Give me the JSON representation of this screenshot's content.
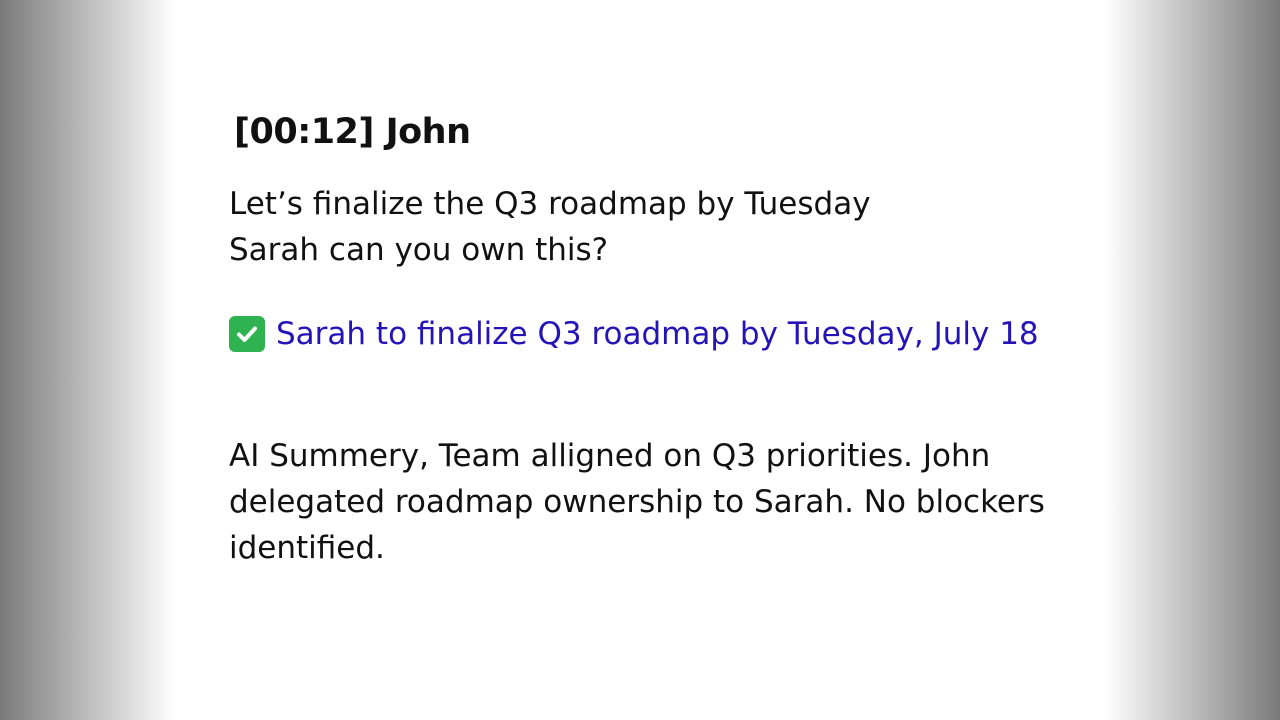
{
  "speaker": {
    "timestamp_label": "[00:12] John"
  },
  "message": {
    "lines": [
      "Let’s finalize the Q3 roadmap by Tuesday",
      "Sarah can you own this?"
    ]
  },
  "action_item": {
    "icon": "check-icon",
    "text": "Sarah to finalize Q3 roadmap by Tuesday, July 18",
    "color": "#2414b8"
  },
  "summary": {
    "text": "AI Summery, Team alligned on Q3 priorities. John delegated roadmap ownership to Sarah. No blockers identified."
  }
}
